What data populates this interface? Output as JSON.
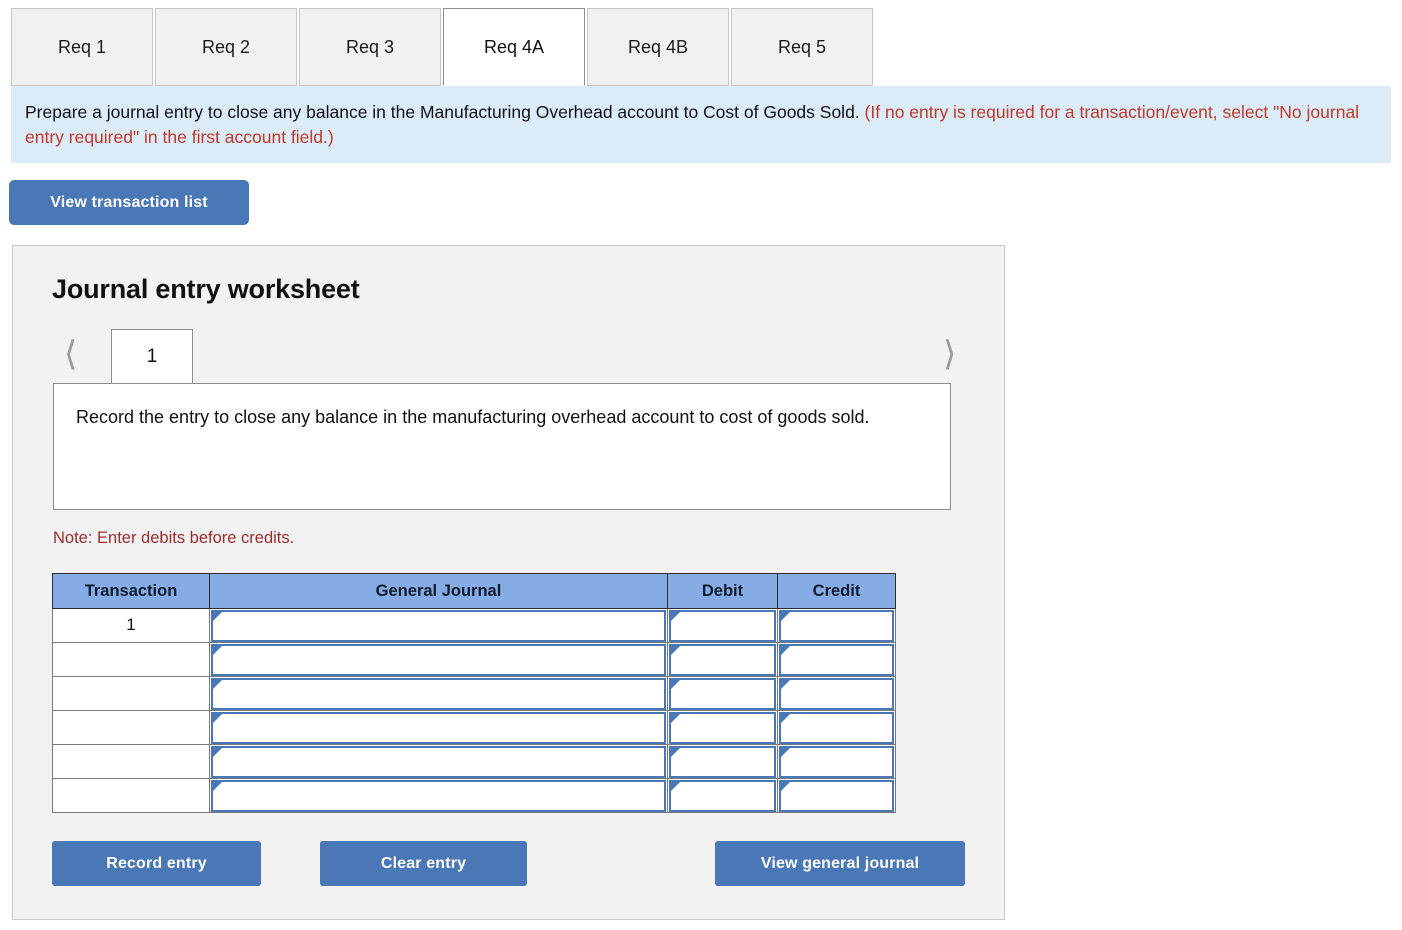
{
  "tabs": [
    {
      "label": "Req 1",
      "active": false
    },
    {
      "label": "Req 2",
      "active": false
    },
    {
      "label": "Req 3",
      "active": false
    },
    {
      "label": "Req 4A",
      "active": true
    },
    {
      "label": "Req 4B",
      "active": false
    },
    {
      "label": "Req 5",
      "active": false
    }
  ],
  "banner": {
    "main": "Prepare a journal entry to close any balance in the Manufacturing Overhead account to Cost of Goods Sold.",
    "note": "(If no entry is required for a transaction/event, select \"No journal entry required\" in the first account field.)",
    "bg_color": "#dcebf8",
    "note_color": "#c0392b"
  },
  "toolbar": {
    "view_transaction_list_label": "View transaction list"
  },
  "worksheet": {
    "title": "Journal entry worksheet",
    "pager": {
      "prev_icon": "chevron-left-icon",
      "next_icon": "chevron-right-icon",
      "current_page": "1"
    },
    "description": "Record the entry to close any balance in the manufacturing overhead account to cost of goods sold.",
    "note": "Note: Enter debits before credits.",
    "table": {
      "headers": [
        "Transaction",
        "General Journal",
        "Debit",
        "Credit"
      ],
      "header_bg": "#85ace4",
      "rows": [
        {
          "transaction": "1",
          "general_journal": "",
          "debit": "",
          "credit": ""
        },
        {
          "transaction": "",
          "general_journal": "",
          "debit": "",
          "credit": ""
        },
        {
          "transaction": "",
          "general_journal": "",
          "debit": "",
          "credit": ""
        },
        {
          "transaction": "",
          "general_journal": "",
          "debit": "",
          "credit": ""
        },
        {
          "transaction": "",
          "general_journal": "",
          "debit": "",
          "credit": ""
        },
        {
          "transaction": "",
          "general_journal": "",
          "debit": "",
          "credit": ""
        }
      ]
    },
    "buttons": {
      "record_entry": "Record entry",
      "clear_entry": "Clear entry",
      "view_general_journal": "View general journal",
      "color": "#4a77b5"
    }
  }
}
